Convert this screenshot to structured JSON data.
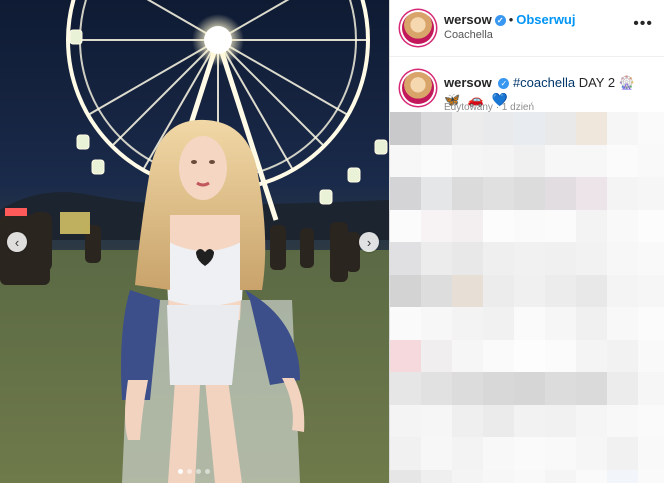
{
  "header": {
    "username": "wersow",
    "separator": "•",
    "follow_label": "Obserwuj",
    "location": "Coachella",
    "verified_glyph": "✓",
    "more_glyph": "•••"
  },
  "caption": {
    "username": "wersow",
    "hashtag": "#coachella",
    "text": " DAY 2 ",
    "emojis": "🎡 🦋 🚗 💙",
    "meta": "Edytowany · 1 dzień"
  },
  "carousel": {
    "prev_glyph": "‹",
    "next_glyph": "›",
    "slide_count": 4,
    "active_slide": 1
  },
  "colors": {
    "link": "#0095f6",
    "verified": "#3897f0",
    "hashtag": "#00376b"
  },
  "blur_palette": [
    "#c9c9cb",
    "#d9d9db",
    "#ececec",
    "#e8eaec",
    "#e8ecf0",
    "#e9e9e9",
    "#efe6dc",
    "#f6f6f6",
    "#fafafa",
    "#f7f7f7",
    "#fafafa",
    "#f5f5f5",
    "#f4f4f4",
    "#f0f0f0",
    "#f7f7f7",
    "#f7f7f7",
    "#fbfbfb",
    "#f9f9f9",
    "#d4d4d6",
    "#e4e6e8",
    "#dbdbdb",
    "#e0e0e0",
    "#dcdcdc",
    "#e2dde0",
    "#ece4e8",
    "#f4f4f4",
    "#f6f6f6",
    "#fbfbfb",
    "#f7f3f4",
    "#f3eef0",
    "#fcfcfc",
    "#fafafa",
    "#fbfbfb",
    "#f3f3f3",
    "#f9f9f9",
    "#fcfcfc",
    "#e0e0e2",
    "#ececec",
    "#e8e8e8",
    "#efefef",
    "#f1f1f1",
    "#f0f0f0",
    "#f2f2f2",
    "#f7f7f7",
    "#f9f9f9",
    "#d3d3d3",
    "#dddddd",
    "#e7dfd6",
    "#ececec",
    "#f0f0f0",
    "#ececec",
    "#e8e8e8",
    "#f4f4f4",
    "#f6f6f6",
    "#fafafa",
    "#f7f7f7",
    "#f3f3f3",
    "#f1f1f1",
    "#fafafa",
    "#f6f6f6",
    "#f0f0f0",
    "#f8f8f8",
    "#fbfbfb",
    "#f6d9dd",
    "#f1eef0",
    "#f6f6f6",
    "#fafafa",
    "#fdfdfd",
    "#fbfbfb",
    "#f4f4f4",
    "#f2f2f2",
    "#f9f9f9",
    "#e6e6e6",
    "#e1e1e1",
    "#dcdcdc",
    "#d8d8d8",
    "#d6d6d6",
    "#dcdcdc",
    "#dadada",
    "#ececec",
    "#f6f6f6",
    "#f4f4f4",
    "#f6f6f6",
    "#efefef",
    "#ebebeb",
    "#f2f2f2",
    "#f1f1f1",
    "#f5f5f5",
    "#f8f8f8",
    "#fafafa",
    "#f1f1f1",
    "#f7f7f7",
    "#f3f3f3",
    "#f8f8f8",
    "#fafafa",
    "#f9f9f9",
    "#f6f6f6",
    "#f1f1f1",
    "#f9f9f9",
    "#e6e6e6",
    "#efefef",
    "#f4f4f4",
    "#f7f7f7",
    "#f9f9f9",
    "#f5f5f5",
    "#fafafa",
    "#f2f6fb",
    "#fafafa"
  ]
}
